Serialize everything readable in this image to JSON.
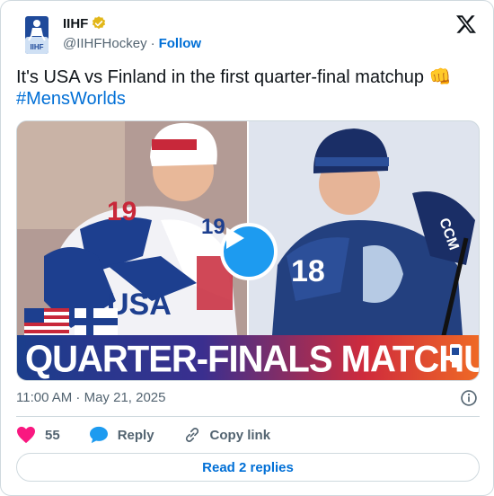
{
  "author": {
    "name": "IIHF",
    "handle": "@IIHFHockey",
    "separator": "·",
    "follow_label": "Follow",
    "verified_color": "#e2b719"
  },
  "tweet": {
    "text": "It's USA vs Finland in the first quarter-final matchup 👊",
    "hashtag": "#MensWorlds"
  },
  "media": {
    "banner_text": "QUARTER-FINALS MATCHUP",
    "player_left_number": "19",
    "player_right_number": "18",
    "jersey_left_letters": "USA",
    "sponsor_text": "CCM"
  },
  "meta": {
    "timestamp": "11:00 AM · May 21, 2025"
  },
  "actions": {
    "like_count": "55",
    "reply_label": "Reply",
    "copy_label": "Copy link"
  },
  "read_replies_label": "Read 2 replies",
  "colors": {
    "accent": "#006fd6",
    "like": "#f91880",
    "play": "#1d9bf0"
  }
}
